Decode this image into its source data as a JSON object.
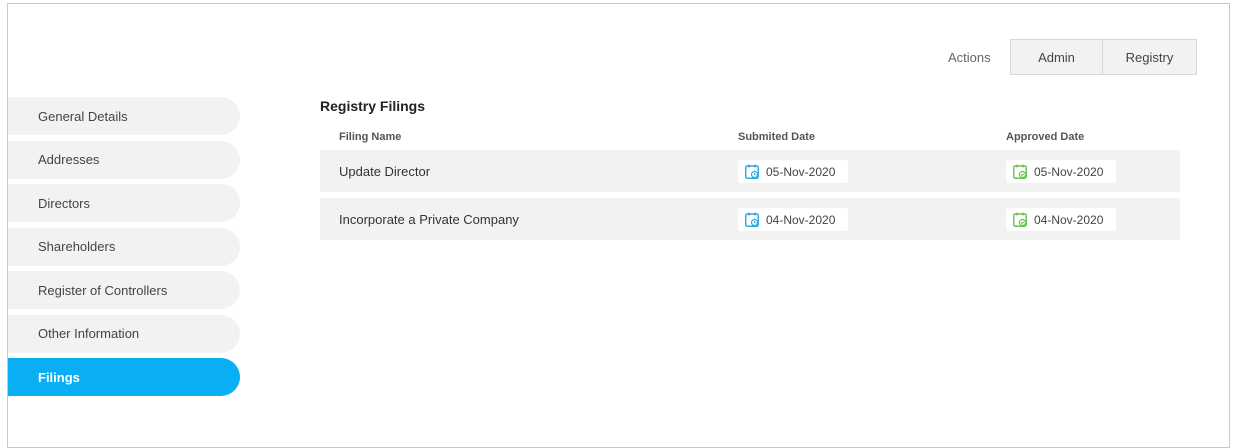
{
  "actions": {
    "label": "Actions",
    "buttons": [
      "Admin",
      "Registry"
    ]
  },
  "sidebar": {
    "items": [
      {
        "label": "General Details",
        "active": false
      },
      {
        "label": "Addresses",
        "active": false
      },
      {
        "label": "Directors",
        "active": false
      },
      {
        "label": "Shareholders",
        "active": false
      },
      {
        "label": "Register of Controllers",
        "active": false
      },
      {
        "label": "Other Information",
        "active": false
      },
      {
        "label": "Filings",
        "active": true
      }
    ]
  },
  "filings": {
    "title": "Registry Filings",
    "columns": {
      "name": "Filing Name",
      "submitted": "Submited Date",
      "approved": "Approved Date"
    },
    "rows": [
      {
        "name": "Update Director",
        "submitted": "05-Nov-2020",
        "approved": "05-Nov-2020"
      },
      {
        "name": "Incorporate a Private Company",
        "submitted": "04-Nov-2020",
        "approved": "04-Nov-2020"
      }
    ]
  },
  "colors": {
    "accent": "#0aaef2",
    "submitted_icon": "#29a9e0",
    "approved_icon": "#6cc04a"
  },
  "icons": {
    "submitted": "calendar-clock-icon",
    "approved": "calendar-check-icon"
  }
}
